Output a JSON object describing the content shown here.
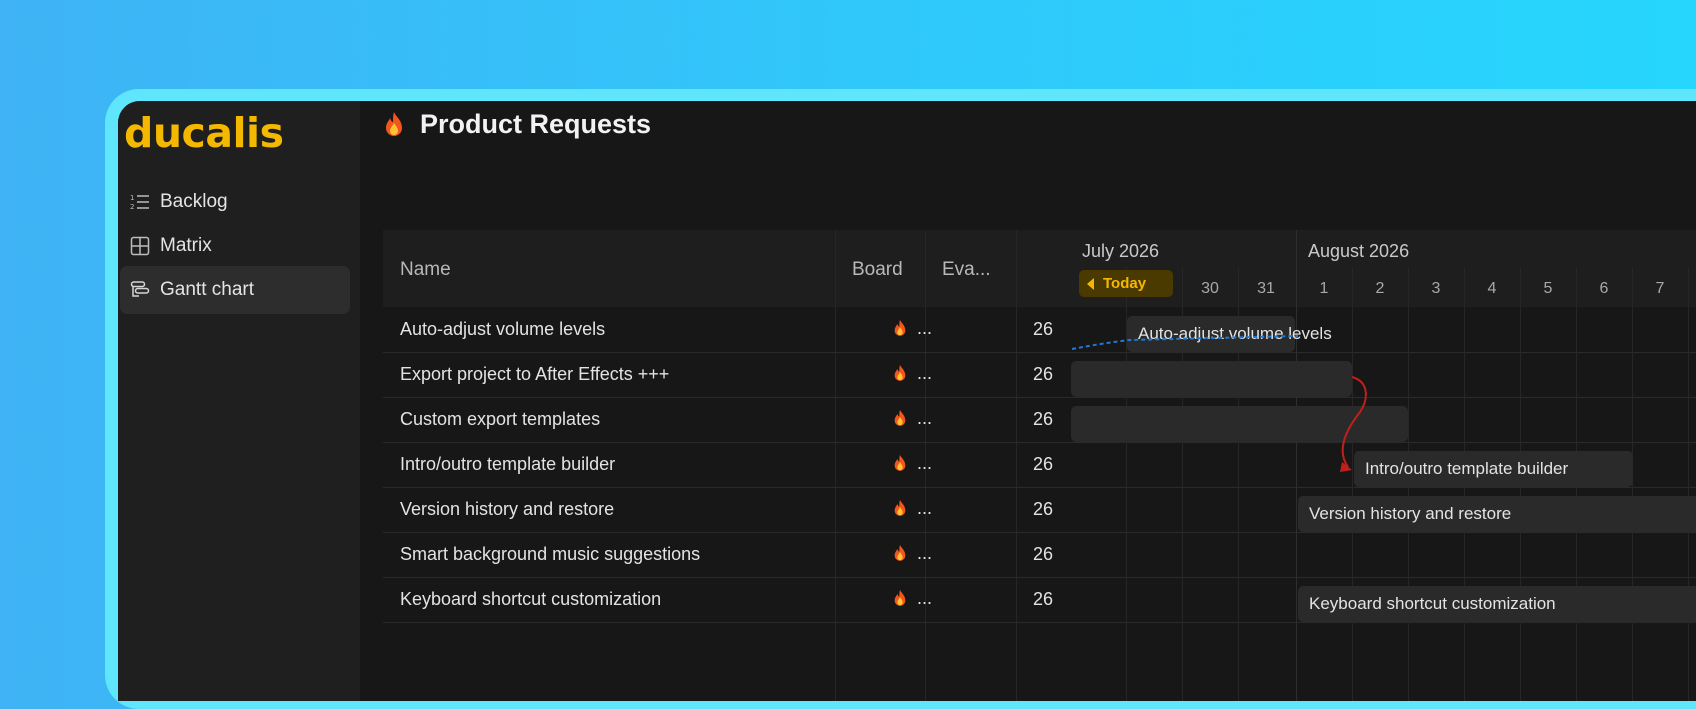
{
  "app": {
    "logo": "ducalis"
  },
  "sidebar": {
    "items": [
      {
        "label": "Backlog",
        "icon": "list-numbered-icon"
      },
      {
        "label": "Matrix",
        "icon": "grid-icon"
      },
      {
        "label": "Gantt chart",
        "icon": "gantt-icon",
        "active": true
      }
    ]
  },
  "page": {
    "title": "Product Requests",
    "title_icon": "fire-icon"
  },
  "table": {
    "columns": {
      "name": "Name",
      "board": "Board",
      "eval": "Eva..."
    },
    "rows": [
      {
        "name": "Auto-adjust volume levels",
        "board": "...",
        "eval": "26"
      },
      {
        "name": "Export project to After Effects +++",
        "board": "...",
        "eval": "26"
      },
      {
        "name": "Custom export templates",
        "board": "...",
        "eval": "26"
      },
      {
        "name": "Intro/outro template builder",
        "board": "...",
        "eval": "26"
      },
      {
        "name": "Version history and restore",
        "board": "...",
        "eval": "26"
      },
      {
        "name": "Smart background music suggestions",
        "board": "...",
        "eval": "26"
      },
      {
        "name": "Keyboard shortcut customization",
        "board": "...",
        "eval": "26"
      }
    ]
  },
  "gantt": {
    "months": [
      "July 2026",
      "August 2026"
    ],
    "today_label": "Today",
    "days": [
      "30",
      "31",
      "1",
      "2",
      "3",
      "4",
      "5",
      "6",
      "7"
    ],
    "bars": [
      {
        "label": "Auto-adjust volume levels"
      },
      {
        "label": ""
      },
      {
        "label": ""
      },
      {
        "label": "Intro/outro template builder"
      },
      {
        "label": "Version history and restore"
      },
      {
        "label": ""
      },
      {
        "label": "Keyboard shortcut customization"
      }
    ],
    "colors": {
      "accent": "#f5b800",
      "dependency_link": "#c0201c",
      "timeline_link": "#1f7ad6"
    }
  }
}
